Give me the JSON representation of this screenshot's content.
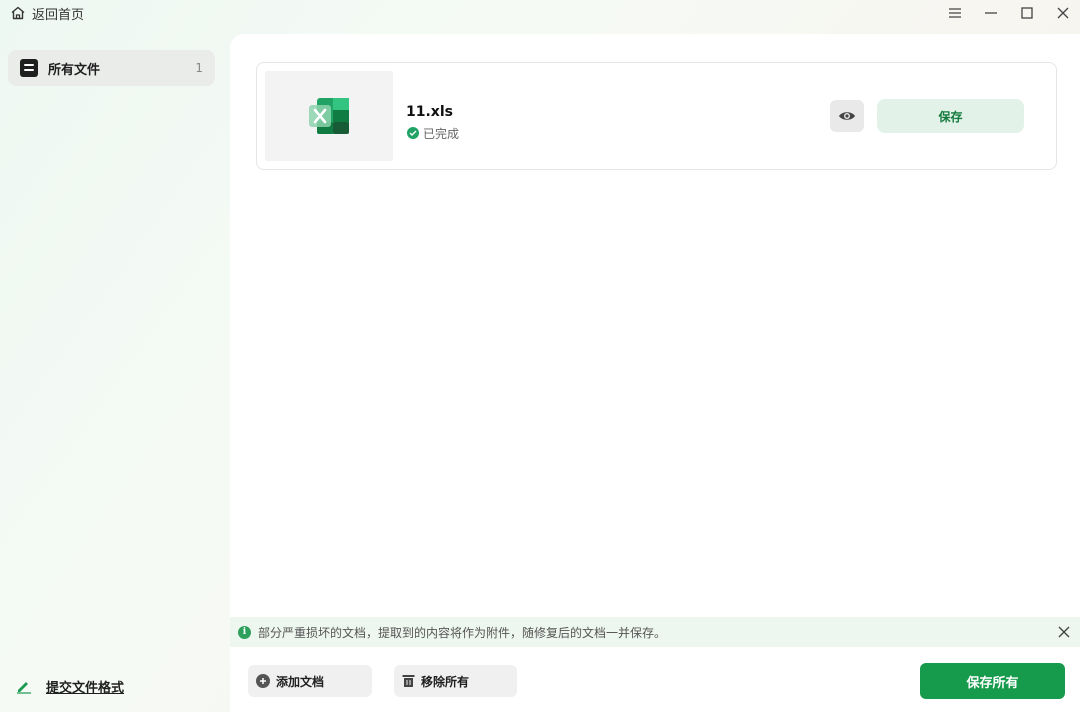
{
  "titlebar": {
    "back_label": "返回首页"
  },
  "sidebar": {
    "items": [
      {
        "label": "所有文件",
        "count": "1"
      }
    ],
    "submit_format_label": "提交文件格式"
  },
  "files": [
    {
      "name": "11.xls",
      "status": "已完成",
      "save_label": "保存"
    }
  ],
  "info_banner": {
    "text": "部分严重损坏的文档，提取到的内容将作为附件，随修复后的文档一并保存。"
  },
  "footer": {
    "add_label": "添加文档",
    "remove_label": "移除所有",
    "save_all_label": "保存所有"
  },
  "colors": {
    "accent": "#169a4c",
    "accent_light": "#e2f2e8",
    "excel_green": "#21a366"
  }
}
